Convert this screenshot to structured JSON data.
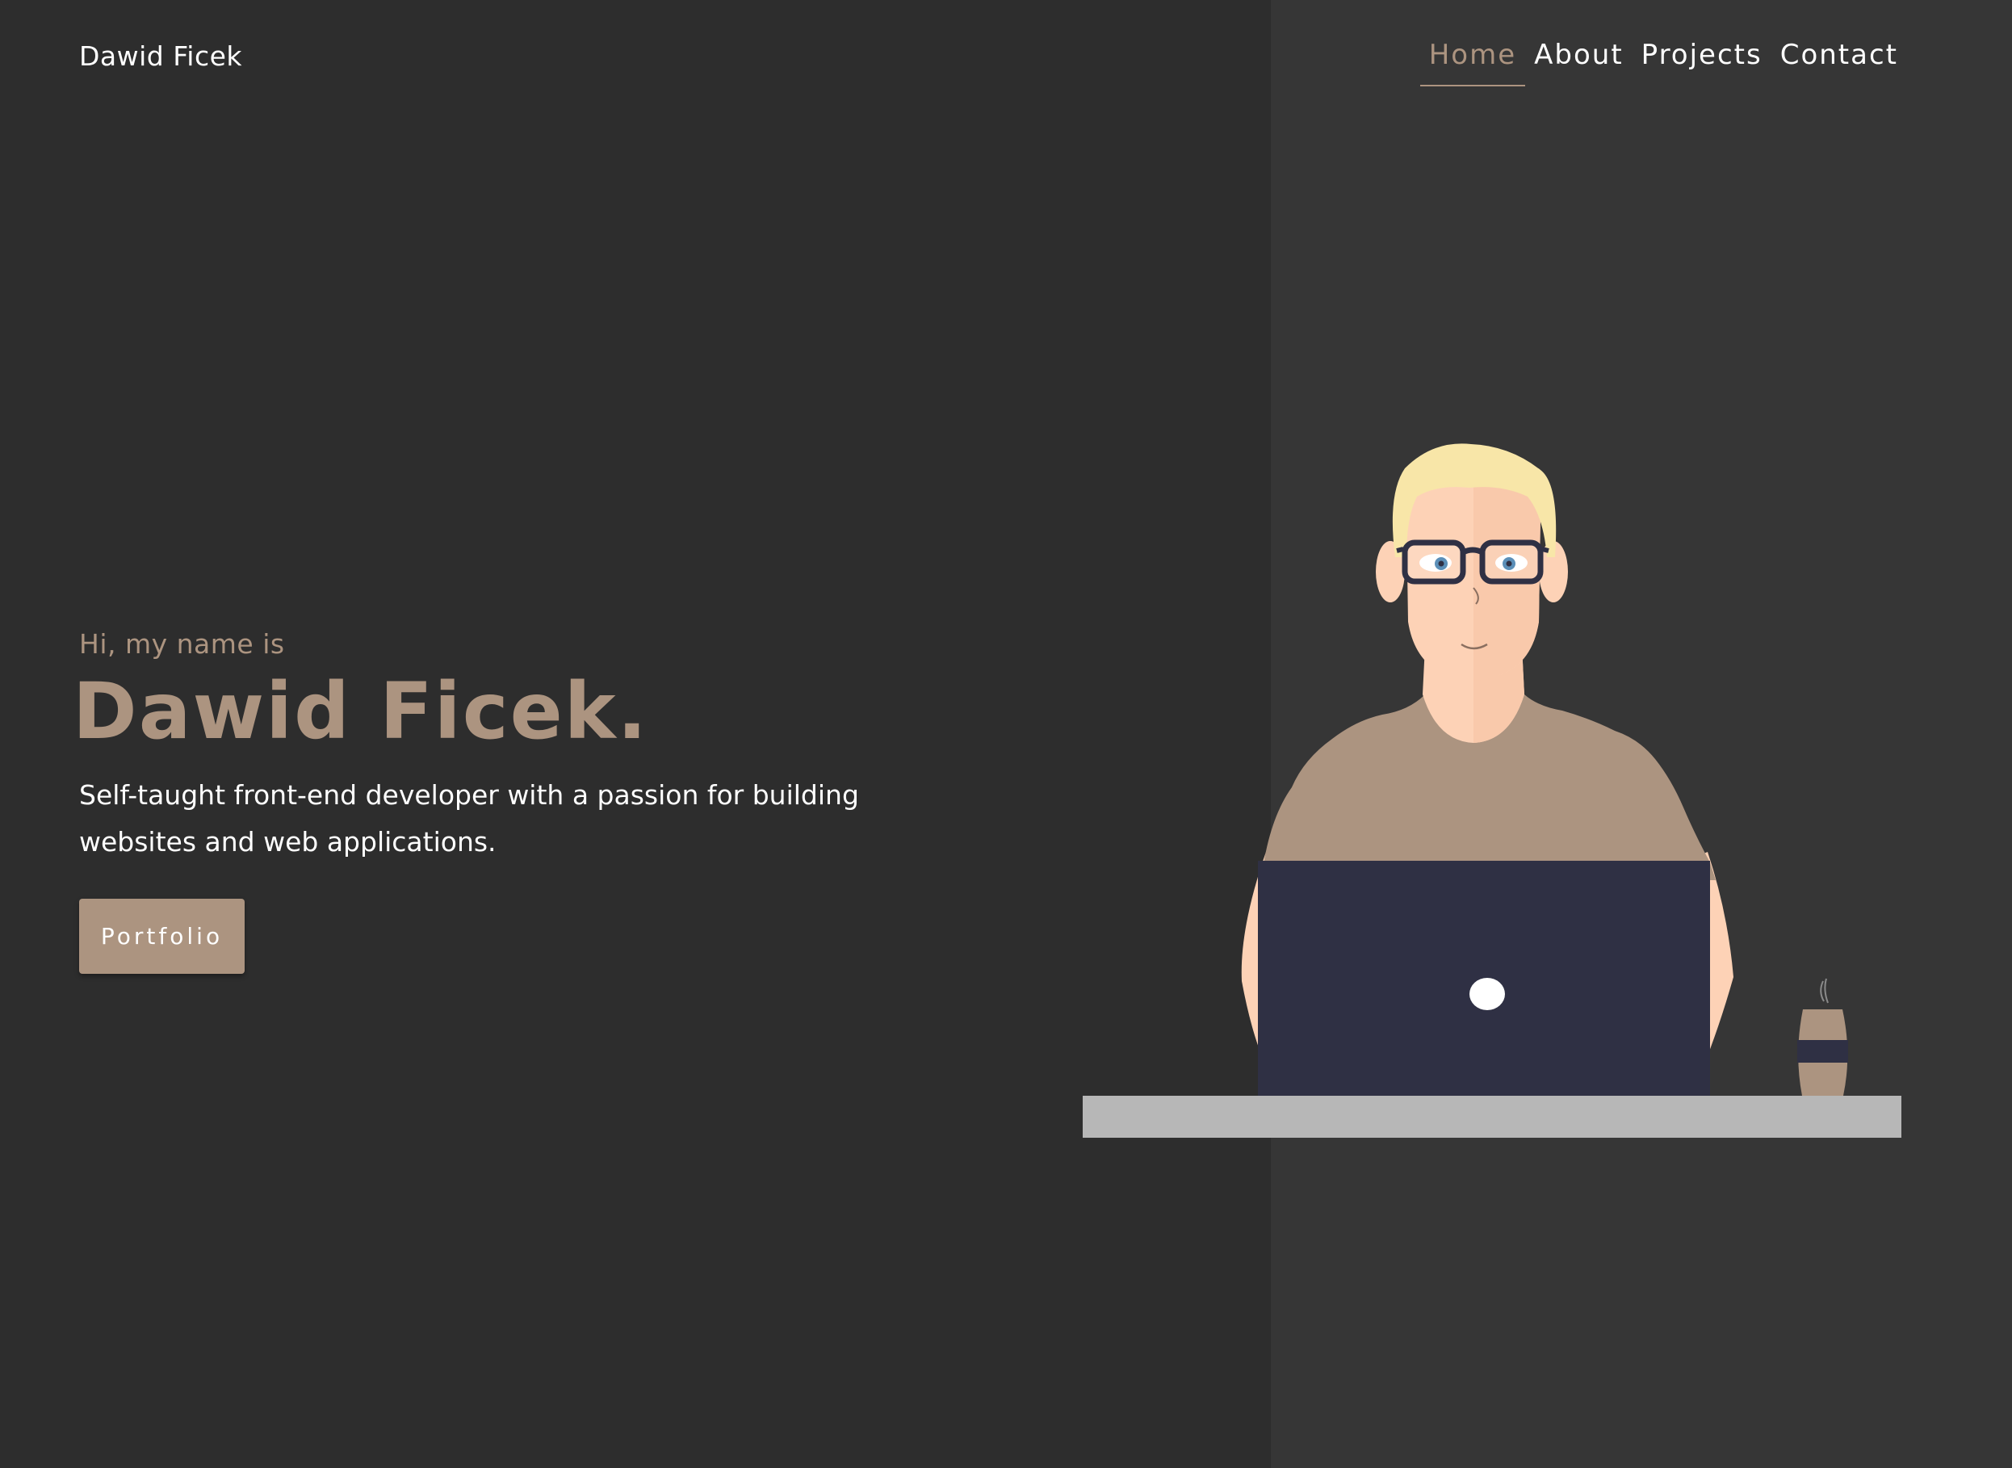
{
  "header": {
    "brand": "Dawid Ficek",
    "nav": [
      {
        "label": "Home",
        "active": true
      },
      {
        "label": "About",
        "active": false
      },
      {
        "label": "Projects",
        "active": false
      },
      {
        "label": "Contact",
        "active": false
      }
    ]
  },
  "hero": {
    "greeting": "Hi, my name is",
    "name": "Dawid Ficek.",
    "description": "Self-taught front-end developer with a passion for building websites and web applications.",
    "button_label": "Portfolio"
  },
  "colors": {
    "background_left": "#2d2d2d",
    "background_right": "#363636",
    "accent": "#ac9480",
    "text": "#ffffff",
    "laptop": "#2f3044",
    "desk": "#b7b7b7",
    "hair": "#f8e6a8",
    "skin": "#fdd2b6"
  },
  "icons": {
    "illustration": "developer-at-laptop-illustration"
  }
}
